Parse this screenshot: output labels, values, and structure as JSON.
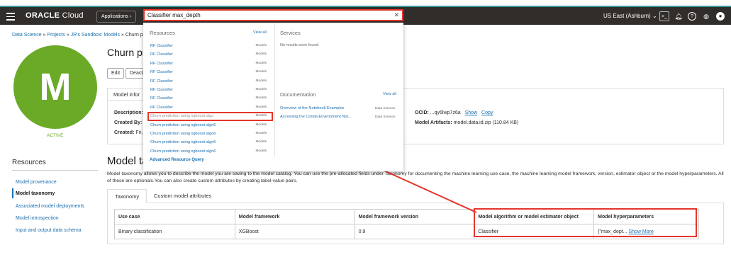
{
  "topbar": {
    "brand": "ORACLE",
    "brand_cloud": "Cloud",
    "applications_label": "Applications",
    "region": "US East (Ashburn)"
  },
  "search": {
    "value": "Classifier max_depth"
  },
  "dropdown": {
    "resources_header": "Resources",
    "view_all": "View all",
    "services_header": "Services",
    "services_empty": "No results were found.",
    "documentation_header": "Documentation",
    "doc_view_all": "View all",
    "advanced_query": "Advanced Resource Query",
    "results": [
      {
        "name": "RF Classifier",
        "type": "Models"
      },
      {
        "name": "RF Classifier",
        "type": "Models"
      },
      {
        "name": "RF Classifier",
        "type": "Models"
      },
      {
        "name": "RF Classifier",
        "type": "Models"
      },
      {
        "name": "RF Classifier",
        "type": "Models"
      },
      {
        "name": "RF Classifier",
        "type": "Models"
      },
      {
        "name": "RF Classifier",
        "type": "Models"
      },
      {
        "name": "RF Classifier",
        "type": "Models"
      },
      {
        "name": "Churn prediction using xgboost algo",
        "type": "Models"
      },
      {
        "name": "Churn prediction using xgboost algo6",
        "type": "Models"
      },
      {
        "name": "Churn prediction using xgboost algo6",
        "type": "Models"
      },
      {
        "name": "Churn prediction using xgboost algo6",
        "type": "Models"
      },
      {
        "name": "Churn prediction using xgboost algo6",
        "type": "Models"
      }
    ],
    "docs": [
      {
        "name": "Overview of the Notebook Examples",
        "type": "Data Science"
      },
      {
        "name": "Accessing the Conda Environment Not...",
        "type": "Data Science"
      }
    ]
  },
  "breadcrumb": {
    "part1": "Data Science",
    "part2": "Projects",
    "part3": "JR's Sandbox: Models",
    "part4": "Churn pr",
    "sep": "»"
  },
  "model": {
    "avatar_letter": "M",
    "status": "ACTIVE",
    "title": "Churn pr",
    "edit_label": "Edit",
    "deactivate_label": "Deacti",
    "info_tab": "Model infor",
    "description_label": "Description:",
    "created_by_label": "Created By:",
    "created_by_value": "j",
    "created_label": "Created:",
    "created_value": "Fri,",
    "ocid_label": "OCID:",
    "ocid_value": "...qy6lwp7z6a",
    "show_label": "Show",
    "copy_label": "Copy",
    "artifacts_label": "Model Artifacts:",
    "artifacts_value": "model.data.id.zip (110.84 KB)"
  },
  "resources": {
    "header": "Resources",
    "items": [
      "Model provenance",
      "Model taxonomy",
      "Associated model deployments",
      "Model introspection",
      "Input and output data schema"
    ]
  },
  "taxonomy": {
    "heading": "Model ta",
    "description": "Model taxonomy allows you to describe the model you are saving to the model catalog. You can use the pre-allocated fields under Taxonomy for documenting the machine learning use case, the machine learning model framework, version, estimator object or the model hyperparameters. All of these are optionals.You can also create custom attributes by creating label-value pairs.",
    "tabs": [
      "Taxonomy",
      "Custom model attributes"
    ],
    "columns": [
      "Use case",
      "Model framework",
      "Model framework version",
      "Model algorithm or model estimator object",
      "Model hyperparameters"
    ],
    "row": [
      "Binary classification",
      "XGBoost",
      "0.9",
      "Classifier",
      "{\"max_dept..."
    ],
    "show_more": "Show More"
  },
  "colors": {
    "topbar": "#312d2a",
    "accent_red": "#e5352b",
    "link": "#1a6fb0",
    "avatar_green": "#6aaa27"
  }
}
